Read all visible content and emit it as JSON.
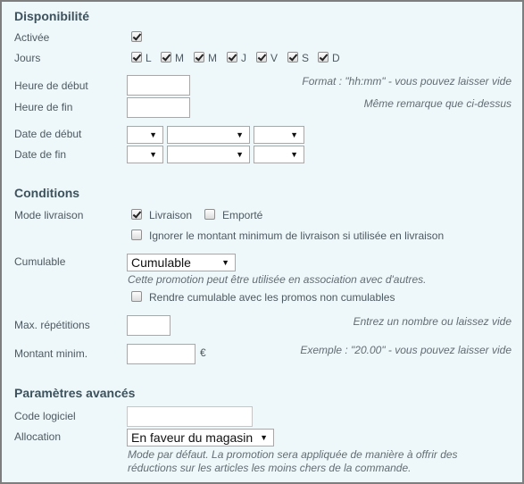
{
  "sections": {
    "availability": {
      "title": "Disponibilité",
      "enabled_label": "Activée",
      "enabled_checked": true,
      "days_label": "Jours",
      "days": [
        {
          "label": "L",
          "checked": true
        },
        {
          "label": "M",
          "checked": true
        },
        {
          "label": "M",
          "checked": true
        },
        {
          "label": "J",
          "checked": true
        },
        {
          "label": "V",
          "checked": true
        },
        {
          "label": "S",
          "checked": true
        },
        {
          "label": "D",
          "checked": true
        }
      ],
      "start_time_label": "Heure de début",
      "start_time_value": "",
      "start_time_hint": "Format : \"hh:mm\" - vous pouvez laisser vide",
      "end_time_label": "Heure de fin",
      "end_time_value": "",
      "end_time_hint": "Même remarque que ci-dessus",
      "start_date_label": "Date de début",
      "end_date_label": "Date de fin",
      "date_day_value": "",
      "date_month_value": "",
      "date_year_value": ""
    },
    "conditions": {
      "title": "Conditions",
      "delivery_mode_label": "Mode livraison",
      "delivery_option": {
        "label": "Livraison",
        "checked": true
      },
      "takeaway_option": {
        "label": "Emporté",
        "checked": false
      },
      "ignore_min_option": {
        "label": "Ignorer le montant minimum de livraison si utilisée en livraison",
        "checked": false
      },
      "cumulable_label": "Cumulable",
      "cumulable_value": "Cumulable",
      "cumulable_hint": "Cette promotion peut être utilisée en association avec d'autres.",
      "make_cumulable_option": {
        "label": "Rendre cumulable avec les promos non cumulables",
        "checked": false
      },
      "max_repeats_label": "Max. répétitions",
      "max_repeats_value": "",
      "max_repeats_hint": "Entrez un nombre ou laissez vide",
      "min_amount_label": "Montant minim.",
      "min_amount_value": "",
      "currency_symbol": "€",
      "min_amount_hint": "Exemple : \"20.00\" - vous pouvez laisser vide"
    },
    "advanced": {
      "title": "Paramètres avancés",
      "software_code_label": "Code logiciel",
      "software_code_value": "",
      "allocation_label": "Allocation",
      "allocation_value": "En faveur du magasin",
      "allocation_hint_line1": "Mode par défaut. La promotion sera appliquée de manière à offrir des",
      "allocation_hint_line2": "réductions sur les articles les moins chers de la commande."
    }
  },
  "icons": {
    "dropdown_arrow": "▼"
  }
}
